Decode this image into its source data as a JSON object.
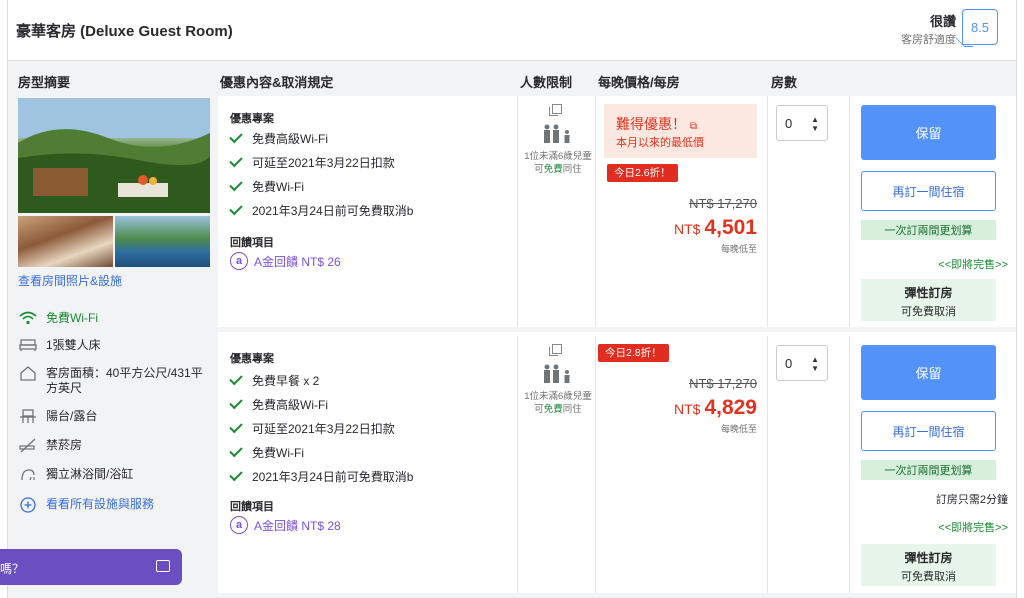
{
  "header": {
    "room_title": "豪華客房 (Deluxe Guest Room)",
    "review_word": "很讚",
    "review_sub": "客房舒適度",
    "review_score": "8.5"
  },
  "columns": {
    "summary": "房型摘要",
    "offer": "優惠內容&取消規定",
    "people": "人數限制",
    "price": "每晚價格/每房",
    "rooms": "房數"
  },
  "summary": {
    "photos_link": "查看房間照片&設施",
    "features": [
      {
        "icon": "wifi-icon",
        "label": "免費Wi-Fi"
      },
      {
        "icon": "bed-icon",
        "label": "1張雙人床"
      },
      {
        "icon": "area-icon",
        "label": "客房面積：40平方公尺/431平方英尺"
      },
      {
        "icon": "balcony-icon",
        "label": "陽台/露台"
      },
      {
        "icon": "no-smoking-icon",
        "label": "禁菸房"
      },
      {
        "icon": "shower-icon",
        "label": "獨立淋浴間/浴缸"
      },
      {
        "icon": "plus-circle-icon",
        "label": "看看所有設施與服務"
      }
    ]
  },
  "offers": [
    {
      "offer_title": "優惠專案",
      "benefits": [
        "免費高級Wi-Fi",
        "可延至2021年3月22日扣款",
        "免費Wi-Fi",
        "2021年3月24日前可免費取消b"
      ],
      "reward_title": "回饋項目",
      "reward": "A金回饋 NT$ 26",
      "people_note_a": "1位未滿6歲兒童可",
      "people_note_free": "免費",
      "people_note_b": "同住",
      "deal_title": "難得優惠！",
      "deal_sub": "本月以來的最低價",
      "discount": "今日2.6折！",
      "original_price": "NT$ 17,270",
      "currency": "NT$",
      "price": "4,501",
      "per_night": "每晚低至",
      "room_qty": "0",
      "reserve_label": "保留",
      "another_label": "再訂一間住宿",
      "two_rooms_label": "一次訂兩間更划算",
      "sellout_label": "<<即將完售>>",
      "flex_title": "彈性訂房",
      "flex_sub": "可免費取消"
    },
    {
      "offer_title": "優惠專案",
      "benefits": [
        "免費早餐 x 2",
        "免費高級Wi-Fi",
        "可延至2021年3月22日扣款",
        "免費Wi-Fi",
        "2021年3月24日前可免費取消b"
      ],
      "reward_title": "回饋項目",
      "reward": "A金回饋 NT$ 28",
      "people_note_a": "1位未滿6歲兒童可",
      "people_note_free": "免費",
      "people_note_b": "同住",
      "discount": "今日2.8折！",
      "original_price": "NT$ 17,270",
      "currency": "NT$",
      "price": "4,829",
      "per_night": "每晚低至",
      "room_qty": "0",
      "reserve_label": "保留",
      "another_label": "再訂一間住宿",
      "two_rooms_label": "一次訂兩間更划算",
      "minutes_label": "訂房只需2分鐘",
      "sellout_label": "<<即將完售>>",
      "flex_title": "彈性訂房",
      "flex_sub": "可免費取消"
    }
  ],
  "chat": {
    "label": "嗎？"
  },
  "colors": {
    "primary": "#5392f9",
    "discount": "#e12d1f",
    "green": "#1a8a34",
    "purple": "#7a50d8",
    "chat": "#6b4fc2"
  }
}
